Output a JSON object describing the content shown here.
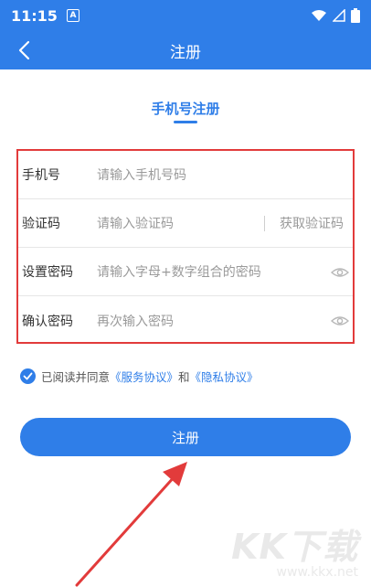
{
  "status_bar": {
    "time": "11:15",
    "notification_badge": "A"
  },
  "app_bar": {
    "title": "注册"
  },
  "subtitle": "手机号注册",
  "form": {
    "rows": [
      {
        "label": "手机号",
        "placeholder": "请输入手机号码"
      },
      {
        "label": "验证码",
        "placeholder": "请输入验证码",
        "action": "获取验证码"
      },
      {
        "label": "设置密码",
        "placeholder": "请输入字母+数字组合的密码",
        "icon": "eye-icon"
      },
      {
        "label": "确认密码",
        "placeholder": "再次输入密码",
        "icon": "eye-icon"
      }
    ]
  },
  "agreement": {
    "prefix": "已阅读并同意",
    "service": "《服务协议》",
    "and": "和",
    "privacy": "《隐私协议》",
    "checked": true
  },
  "submit_label": "注册",
  "watermark": {
    "big": "KK下载",
    "small": "www.kkx.net"
  },
  "colors": {
    "primary": "#2f7ee8",
    "annotation": "#e23b3b"
  }
}
